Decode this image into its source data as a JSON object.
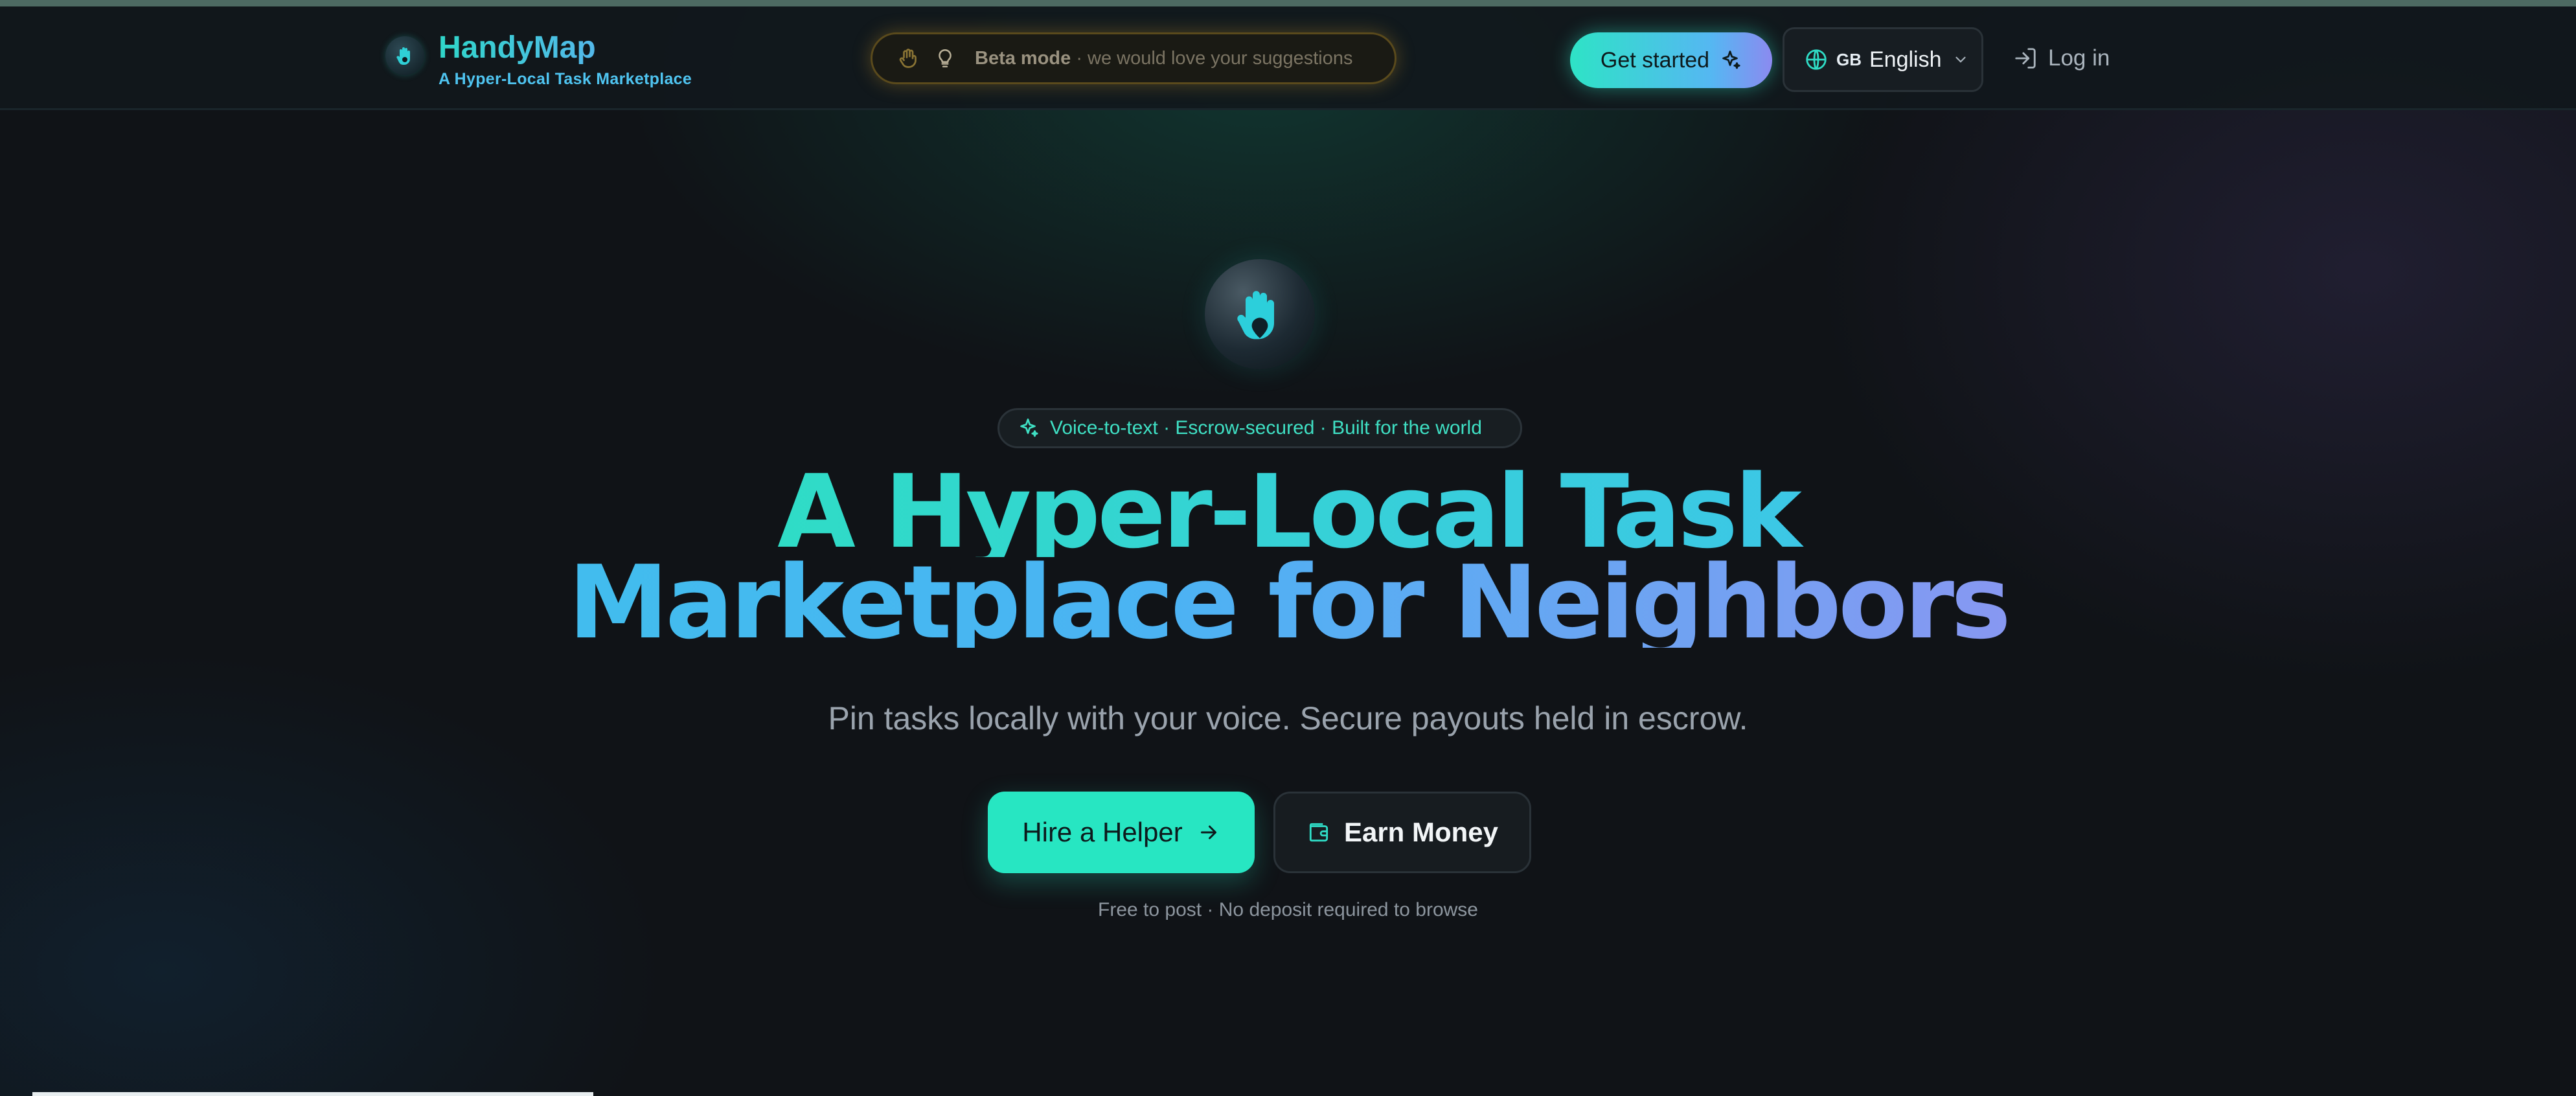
{
  "header": {
    "brand_name": "HandyMap",
    "brand_tagline": "A Hyper-Local Task Marketplace",
    "beta_bold": "Beta mode",
    "beta_rest": " · we would love your suggestions",
    "get_started": "Get started",
    "language_flag": "GB",
    "language": "English",
    "login": "Log in"
  },
  "hero": {
    "features": "Voice-to-text · Escrow-secured · Built for the world",
    "headline_line1": "A Hyper-Local Task",
    "headline_line2": "Marketplace for Neighbors",
    "tagline": "Pin tasks locally with your voice. Secure payouts held in escrow.",
    "hire_button": "Hire a Helper",
    "earn_button": "Earn Money",
    "note": "Free to post · No deposit required to browse"
  },
  "colors": {
    "accent_teal": "#27e6c2",
    "accent_blue": "#4bb3f3",
    "accent_violet": "#a58ef0",
    "background": "#101317"
  },
  "icons": [
    "hand-pin-icon",
    "wave-hand-icon",
    "lightbulb-icon",
    "sparkle-icon",
    "globe-icon",
    "chevron-down-icon",
    "login-icon",
    "arrow-right-icon",
    "wallet-icon"
  ]
}
